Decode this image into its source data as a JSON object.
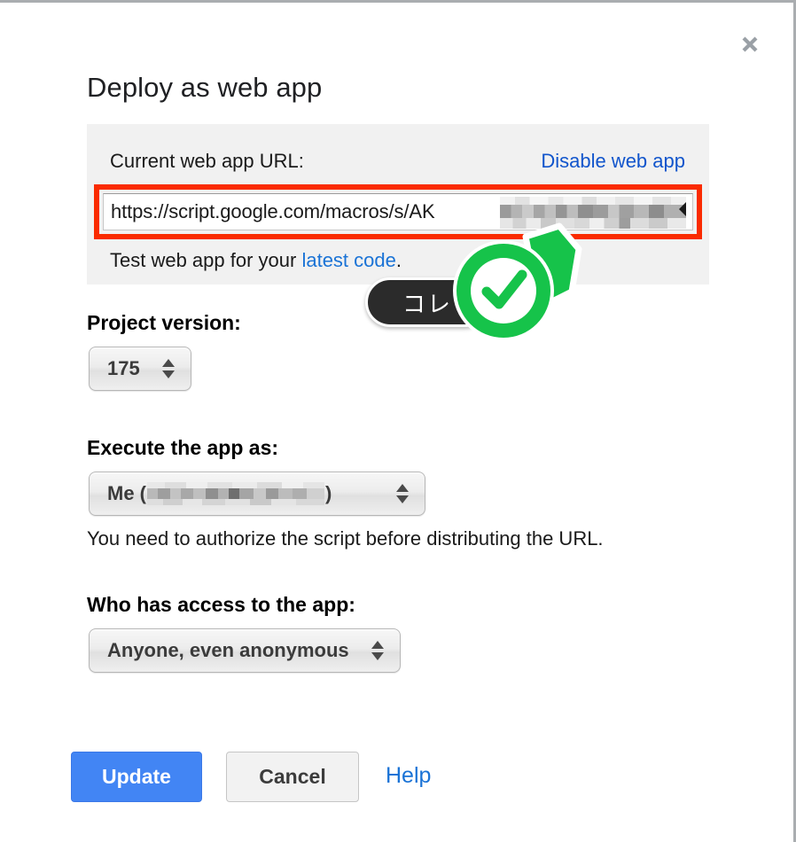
{
  "dialog": {
    "title": "Deploy as web app",
    "close_icon": "close-icon"
  },
  "url_panel": {
    "label": "Current web app URL:",
    "disable_link": "Disable web app",
    "url_value": "https://script.google.com/macros/s/AK",
    "url_redacted_note": "redacted",
    "test_prefix": "Test web app for your ",
    "test_link": "latest code",
    "test_suffix": "."
  },
  "annotation": {
    "pill_text": "コレ",
    "check_icon": "check-circle-icon",
    "pill_color": "#2b2b2b",
    "check_color": "#16c34a",
    "highlight_color": "#fa2b00"
  },
  "project_version": {
    "heading": "Project version:",
    "value": "175"
  },
  "execute_as": {
    "heading": "Execute the app as:",
    "value_prefix": "Me (",
    "value_suffix": ")",
    "note": "You need to authorize the script before distributing the URL."
  },
  "access": {
    "heading": "Who has access to the app:",
    "value": "Anyone, even anonymous"
  },
  "footer": {
    "update_label": "Update",
    "cancel_label": "Cancel",
    "help_label": "Help",
    "primary_color": "#4285f4",
    "link_color": "#1a73d6"
  }
}
